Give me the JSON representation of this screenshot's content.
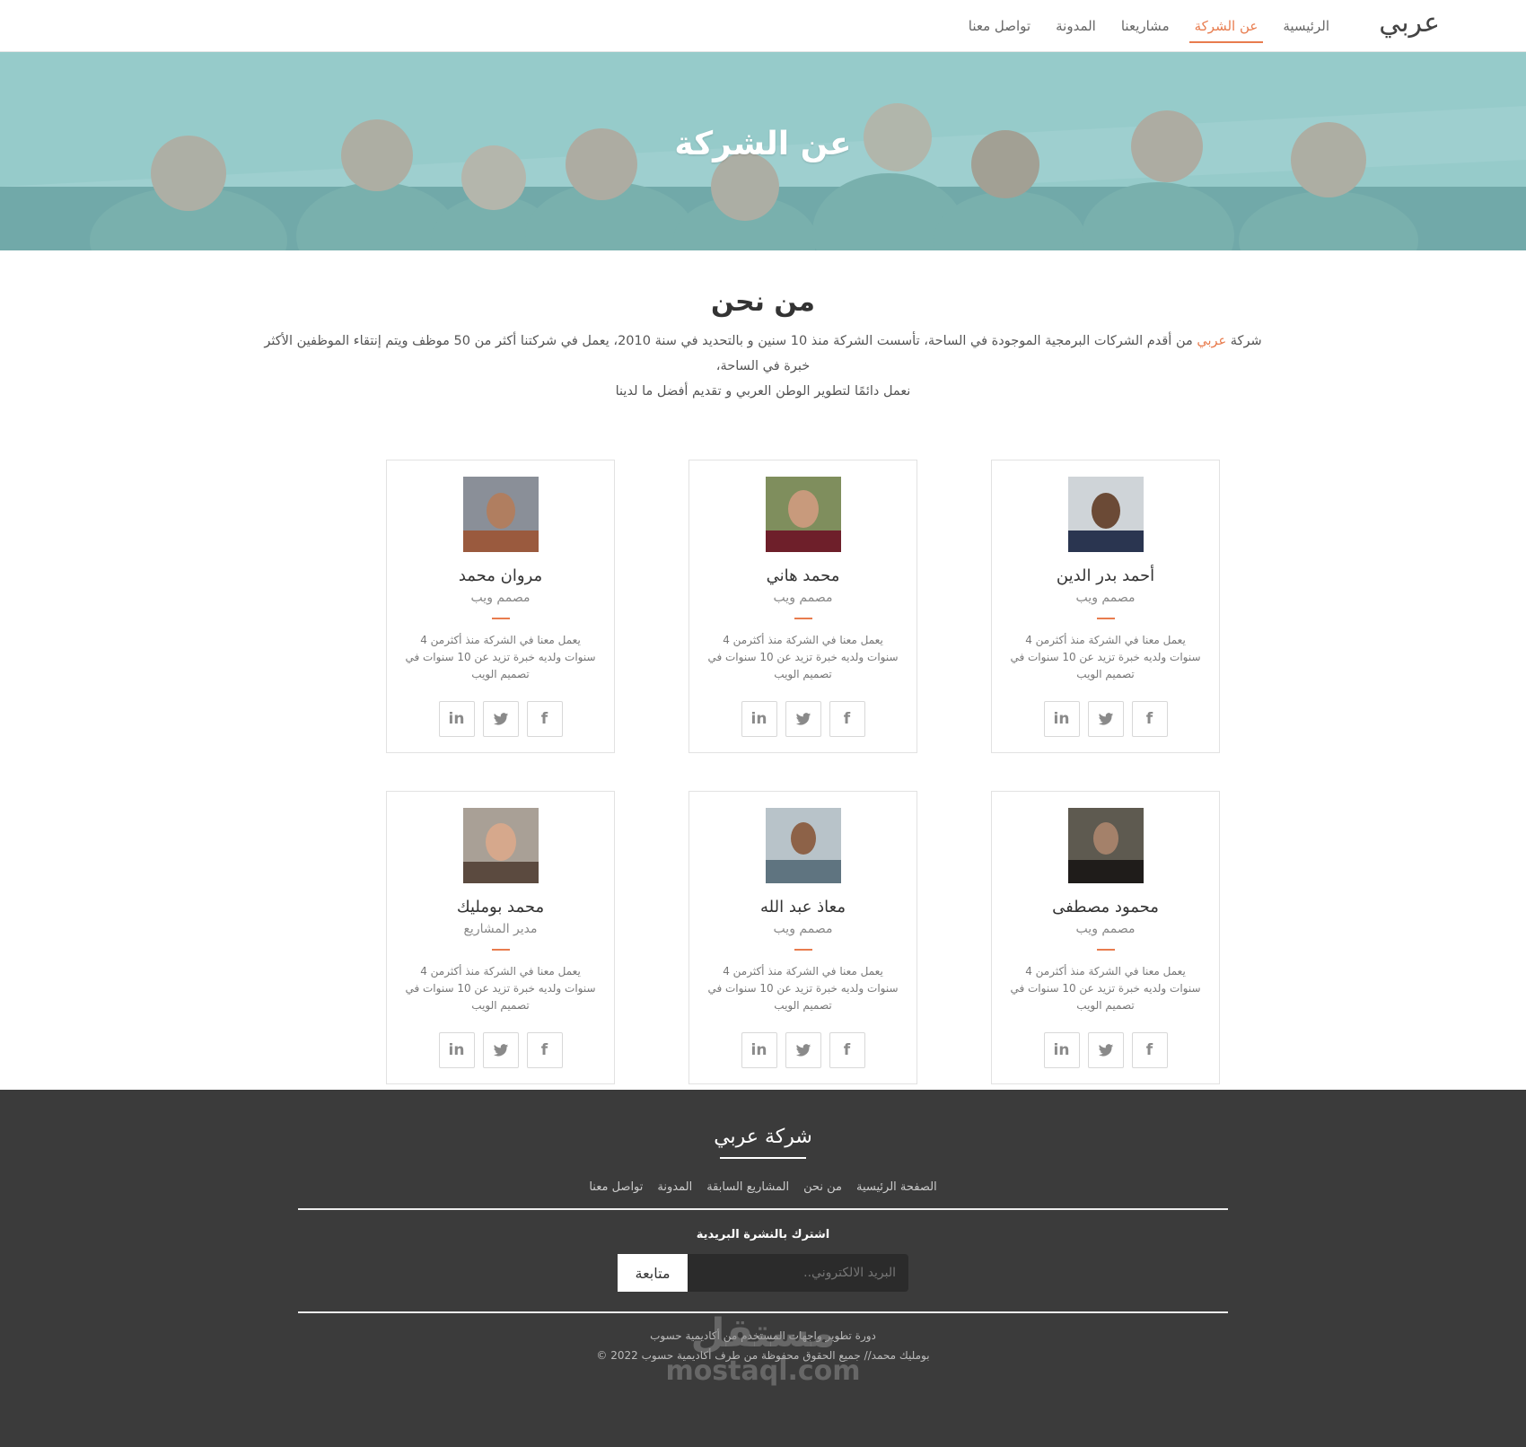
{
  "navbar": {
    "brand": "عربي",
    "links": [
      {
        "label": "الرئيسية",
        "active": false
      },
      {
        "label": "عن الشركة",
        "active": true
      },
      {
        "label": "مشاريعنا",
        "active": false
      },
      {
        "label": "المدونة",
        "active": false
      },
      {
        "label": "تواصل معنا",
        "active": false
      }
    ]
  },
  "hero": {
    "title": "عن الشركة"
  },
  "about": {
    "title": "من نحن",
    "line1_prefix": "شركة ",
    "line1_highlight": "عربي",
    "line1_rest": " من أقدم الشركات البرمجية الموجودة في الساحة، تأسست الشركة منذ 10 سنين و بالتحديد في سنة 2010، يعمل في شركتنا أكثر من 50 موظف ويتم إنتقاء الموظفين الأكثر خبرة في الساحة،",
    "line2": "نعمل دائمًا لتطوير الوطن العربي و تقديم أفضل ما لدينا"
  },
  "team": [
    {
      "name": "أحمد بدر الدين",
      "role": "مصمم ويب",
      "bio": "يعمل معنا في الشركة منذ أكثرمن 4 سنوات ولديه خبرة تزيد عن 10 سنوات في تصميم الويب"
    },
    {
      "name": "محمد هاني",
      "role": "مصمم ويب",
      "bio": "يعمل معنا في الشركة منذ أكثرمن 4 سنوات ولديه خبرة تزيد عن 10 سنوات في تصميم الويب"
    },
    {
      "name": "مروان محمد",
      "role": "مصمم ويب",
      "bio": "يعمل معنا في الشركة منذ أكثرمن 4 سنوات ولديه خبرة تزيد عن 10 سنوات في تصميم الويب"
    },
    {
      "name": "محمود مصطفى",
      "role": "مصمم ويب",
      "bio": "يعمل معنا في الشركة منذ أكثرمن 4 سنوات ولديه خبرة تزيد عن 10 سنوات في تصميم الويب"
    },
    {
      "name": "معاذ عبد الله",
      "role": "مصمم ويب",
      "bio": "يعمل معنا في الشركة منذ أكثرمن 4 سنوات ولديه خبرة تزيد عن 10 سنوات في تصميم الويب"
    },
    {
      "name": "محمد بومليك",
      "role": "مدير المشاريع",
      "bio": "يعمل معنا في الشركة منذ أكثرمن 4 سنوات ولديه خبرة تزيد عن 10 سنوات في تصميم الويب"
    }
  ],
  "social": {
    "facebook_icon": "facebook-icon",
    "twitter_icon": "twitter-icon",
    "linkedin_icon": "linkedin-icon",
    "linkedin_text": "in",
    "facebook_text": "f"
  },
  "footer": {
    "brand": "شركة عربي",
    "links": [
      "الصفحة الرئيسية",
      "من نحن",
      "المشاريع السابقة",
      "المدونة",
      "تواصل معنا"
    ],
    "newsletter_title": "اشترك بالنشرة البريدية",
    "email_placeholder": "البريد الالكتروني..",
    "subscribe_button": "متابعة",
    "copy_line1": "دورة تطوير واجهات المستخدم من أكاديمية حسوب",
    "copy_line2": "بومليك محمد// جميع الحقوق محفوظة من طرف أكاديمية حسوب 2022 ©",
    "watermark_ar": "مستقل",
    "watermark_en": "mostaql.com"
  },
  "colors": {
    "accent": "#e87c4e",
    "footer_bg": "#3b3b3b",
    "hero_tint": "#8fc4c3"
  }
}
